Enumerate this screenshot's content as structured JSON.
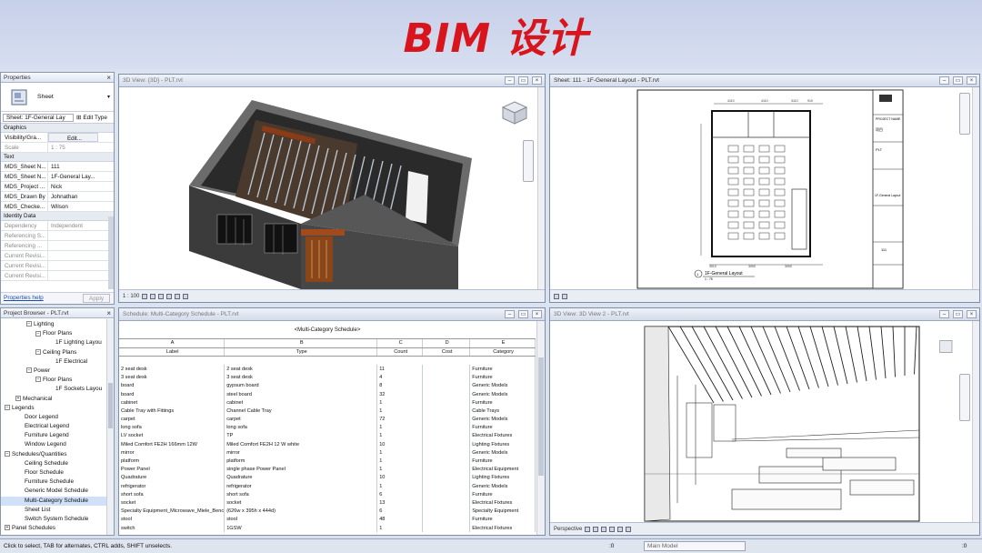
{
  "banner": {
    "title": "BIM 设计"
  },
  "properties": {
    "title": "Properties",
    "type_label": "Sheet",
    "selector": "Sheet: 1F-General Lay",
    "edit_type": "Edit Type",
    "graphics_header": "Graphics",
    "visibility": {
      "k": "Visibility/Gra...",
      "v": "Edit..."
    },
    "scale": {
      "k": "Scale",
      "v": "1 : 75"
    },
    "text_header": "Text",
    "text_rows": [
      {
        "k": "MDS_Sheet N...",
        "v": "111"
      },
      {
        "k": "MDS_Sheet N...",
        "v": "1F-General Lay..."
      },
      {
        "k": "MDS_Project ...",
        "v": "Nick"
      },
      {
        "k": "MDS_Drawn By",
        "v": "Johnathan"
      },
      {
        "k": "MDS_Checke...",
        "v": "Wilson"
      }
    ],
    "identity_header": "Identity Data",
    "identity_rows": [
      {
        "k": "Dependency",
        "v": "Independent"
      },
      {
        "k": "Referencing S...",
        "v": ""
      },
      {
        "k": "Referencing ...",
        "v": ""
      },
      {
        "k": "Current Revisi...",
        "v": ""
      },
      {
        "k": "Current Revisi...",
        "v": ""
      },
      {
        "k": "Current Revisi...",
        "v": ""
      }
    ],
    "help": "Properties help",
    "apply": "Apply"
  },
  "browser": {
    "title": "Project Browser - PLT.rvt",
    "items": [
      {
        "label": "Lighting",
        "indent": 28,
        "exp": "−"
      },
      {
        "label": "Floor Plans",
        "indent": 38,
        "exp": "−"
      },
      {
        "label": "1F Lighting Layou",
        "indent": 60,
        "exp": ""
      },
      {
        "label": "Ceiling Plans",
        "indent": 38,
        "exp": "−"
      },
      {
        "label": "1F Electrical",
        "indent": 60,
        "exp": ""
      },
      {
        "label": "Power",
        "indent": 28,
        "exp": "−"
      },
      {
        "label": "Floor Plans",
        "indent": 38,
        "exp": "−"
      },
      {
        "label": "1F Sockets Layou",
        "indent": 60,
        "exp": ""
      },
      {
        "label": "Mechanical",
        "indent": 16,
        "exp": "+"
      },
      {
        "label": "Legends",
        "indent": 4,
        "exp": "−"
      },
      {
        "label": "Door Legend",
        "indent": 26,
        "exp": ""
      },
      {
        "label": "Electrical Legend",
        "indent": 26,
        "exp": ""
      },
      {
        "label": "Furniture Legend",
        "indent": 26,
        "exp": ""
      },
      {
        "label": "Window Legend",
        "indent": 26,
        "exp": ""
      },
      {
        "label": "Schedules/Quantities",
        "indent": 4,
        "exp": "−"
      },
      {
        "label": "Ceiling Schedule",
        "indent": 26,
        "exp": ""
      },
      {
        "label": "Floor Schedule",
        "indent": 26,
        "exp": ""
      },
      {
        "label": "Furniture Schedule",
        "indent": 26,
        "exp": ""
      },
      {
        "label": "Generic Model Schedule",
        "indent": 26,
        "exp": ""
      },
      {
        "label": "Multi-Category Schedule",
        "indent": 26,
        "exp": "",
        "selected": true
      },
      {
        "label": "Sheet List",
        "indent": 26,
        "exp": ""
      },
      {
        "label": "Switch System Schedule",
        "indent": 26,
        "exp": ""
      },
      {
        "label": "Panel Schedules",
        "indent": 4,
        "exp": "+"
      }
    ]
  },
  "win3d": {
    "title": "3D View: {3D} - PLT.rvt",
    "scale": "1 : 100"
  },
  "winsheet": {
    "title": "Sheet: 111 - 1F-General Layout - PLT.rvt",
    "view_name": "1F-General Layout",
    "view_scale": "1 : 75",
    "dims_top": [
      "4110",
      "4110",
      "3110",
      "910"
    ],
    "dims_bottom": [
      "3010",
      "3000",
      "3000"
    ],
    "block": [
      "PROJECT NAME",
      "项目",
      "PLT",
      "1F-General Layout",
      "111"
    ]
  },
  "winsched": {
    "title": "Schedule: Multi-Category Schedule - PLT.rvt",
    "heading": "<Multi-Category Schedule>",
    "letters": [
      "A",
      "B",
      "C",
      "D",
      "E"
    ],
    "headers": [
      "Label",
      "Type",
      "Count",
      "Cost",
      "Category"
    ],
    "rows": [
      [
        "2 seat desk",
        "2 seat desk",
        "11",
        "",
        "Furniture"
      ],
      [
        "3 seat desk",
        "3 seat desk",
        "4",
        "",
        "Furniture"
      ],
      [
        "board",
        "gypsum board",
        "8",
        "",
        "Generic Models"
      ],
      [
        "board",
        "steel board",
        "32",
        "",
        "Generic Models"
      ],
      [
        "cabinet",
        "cabinet",
        "1",
        "",
        "Furniture"
      ],
      [
        "Cable Tray with Fittings",
        "Channel Cable Tray",
        "1",
        "",
        "Cable Trays"
      ],
      [
        "carpet",
        "carpet",
        "72",
        "",
        "Generic Models"
      ],
      [
        "long sofa",
        "long sofa",
        "1",
        "",
        "Furniture"
      ],
      [
        "LV socket",
        "TP",
        "1",
        "",
        "Electrical Fixtures"
      ],
      [
        "Miled Comfort  FE2H 166mm 12W",
        "Miled Comfort FE2H 12 W white",
        "10",
        "",
        "Lighting Fixtures"
      ],
      [
        "mirror",
        "mirror",
        "1",
        "",
        "Generic Models"
      ],
      [
        "platform",
        "platform",
        "1",
        "",
        "Furniture"
      ],
      [
        "Power Panel",
        "single phase Power Panel",
        "1",
        "",
        "Electrical Equipment"
      ],
      [
        "Quadrature",
        "Quadrature",
        "10",
        "",
        "Lighting Fixtures"
      ],
      [
        "refrigerator",
        "refrigerator",
        "1",
        "",
        "Generic Models"
      ],
      [
        "short sofa",
        "short sofa",
        "6",
        "",
        "Furniture"
      ],
      [
        "socket",
        "socket",
        "13",
        "",
        "Electrical Fixtures"
      ],
      [
        "Specialty Equipment_Microwave_Miele_Benc",
        "(626w x 395h x 444d)",
        "6",
        "",
        "Specialty Equipment"
      ],
      [
        "stool",
        "stool",
        "48",
        "",
        "Furniture"
      ],
      [
        "switch",
        "1GSW",
        "1",
        "",
        "Electrical Fixtures"
      ]
    ]
  },
  "winpersp": {
    "title": "3D View: 3D View 2 - PLT.rvt",
    "mode": "Perspective"
  },
  "status": {
    "hint": "Click to select, TAB for alternates, CTRL adds, SHIFT unselects.",
    "zero": ":0",
    "model": "Main Model",
    "zero2": ":0"
  },
  "colors": {
    "brand_red": "#d8141c",
    "walls": "#3f3f3f",
    "door": "#8a3b17"
  }
}
